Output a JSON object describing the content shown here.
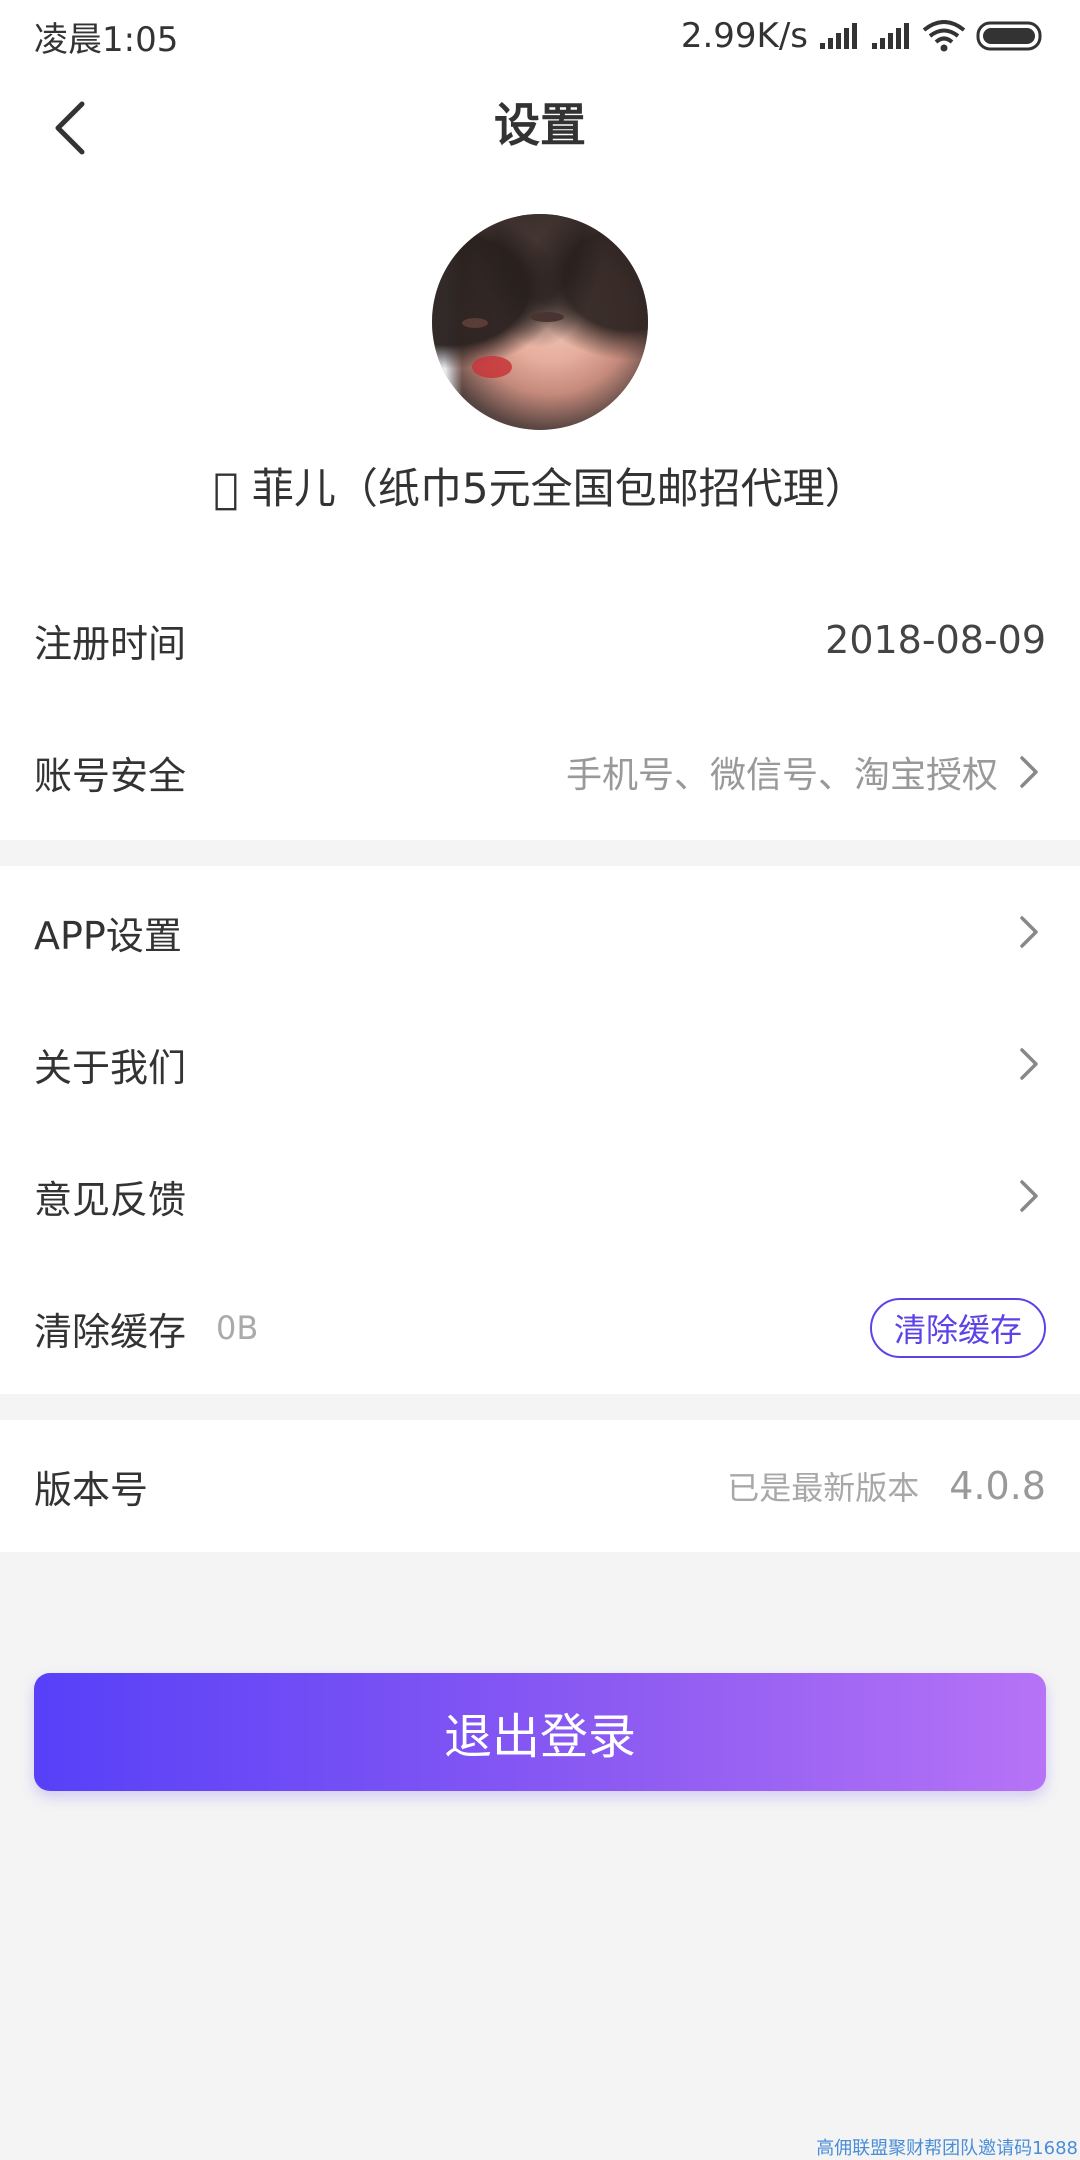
{
  "status_bar": {
    "time": "凌晨1:05",
    "speed": "2.99K/s"
  },
  "nav": {
    "title": "设置",
    "back_icon": "chevron-left-icon"
  },
  "profile": {
    "nickname": "􀀀 菲儿（纸巾5元全国包邮招代理）"
  },
  "rows": {
    "register": {
      "label": "注册时间",
      "value": "2018-08-09"
    },
    "security": {
      "label": "账号安全",
      "value": "手机号、微信号、淘宝授权"
    },
    "app_settings": {
      "label": "APP设置"
    },
    "about": {
      "label": "关于我们"
    },
    "feedback": {
      "label": "意见反馈"
    },
    "cache": {
      "label": "清除缓存",
      "size": "0B",
      "button": "清除缓存"
    },
    "version": {
      "label": "版本号",
      "hint": "已是最新版本",
      "value": "4.0.8"
    }
  },
  "logout": {
    "label": "退出登录"
  },
  "watermark": "高佣联盟聚财帮团队邀请码1688",
  "colors": {
    "accent": "#5b43e8",
    "gradient_start": "#5740f8",
    "gradient_end": "#b673f6",
    "background": "#f4f4f4"
  }
}
